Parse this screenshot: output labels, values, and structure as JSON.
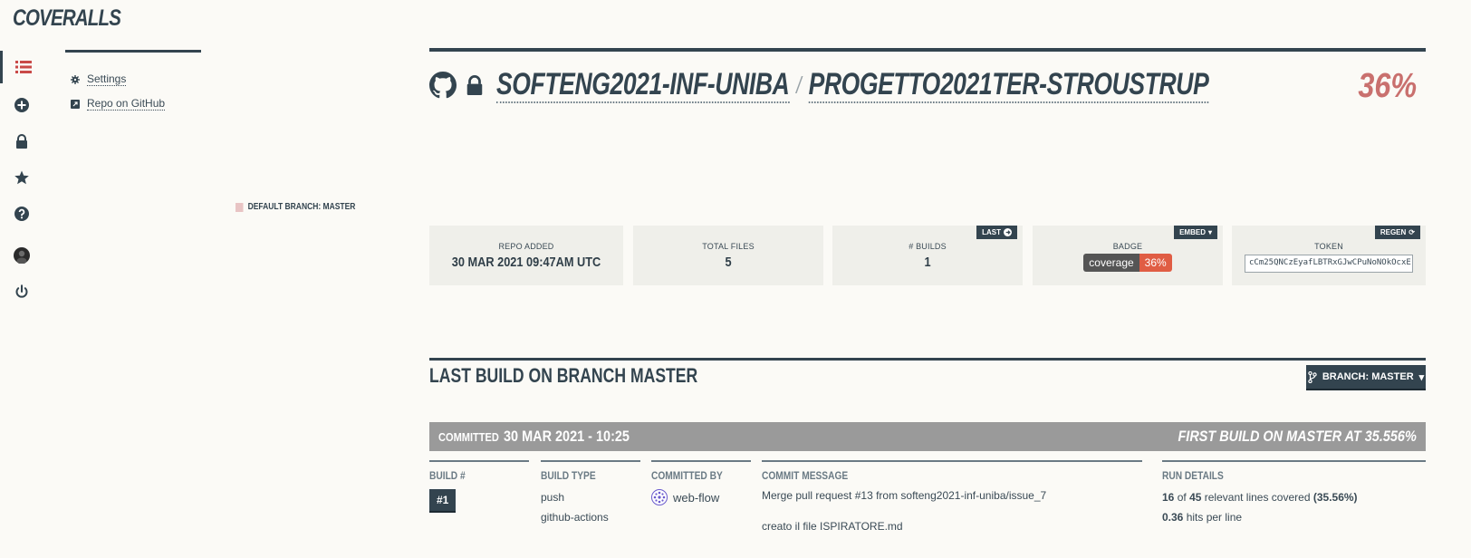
{
  "app": {
    "logo": "COVERALLS"
  },
  "rail": {
    "items": [
      {
        "icon": "list-icon",
        "active": true
      },
      {
        "icon": "add-circle-icon"
      },
      {
        "icon": "lock-icon"
      },
      {
        "icon": "star-icon"
      },
      {
        "icon": "help-icon"
      },
      {
        "icon": "avatar"
      },
      {
        "icon": "power-icon"
      }
    ]
  },
  "sidebar": {
    "links": [
      {
        "label": "Settings",
        "icon": "gear-icon"
      },
      {
        "label": "Repo on GitHub",
        "icon": "external-link-icon"
      }
    ]
  },
  "legend": {
    "label": "DEFAULT BRANCH: MASTER",
    "color": "#e8c4c4"
  },
  "repo": {
    "owner": "SOFTENG2021-INF-UNIBA",
    "separator": "/",
    "name": "PROGETTO2021TER-STROUSTRUP",
    "coverage": "36%"
  },
  "stats": {
    "repo_added": {
      "label": "REPO ADDED",
      "value": "30 MAR 2021 09:47AM UTC"
    },
    "total_files": {
      "label": "TOTAL FILES",
      "value": "5"
    },
    "builds": {
      "label": "# BUILDS",
      "value": "1",
      "tag": "LAST"
    },
    "badge": {
      "label": "BADGE",
      "tag": "EMBED",
      "left": "coverage",
      "right": "36%"
    },
    "token": {
      "label": "TOKEN",
      "tag": "REGEN",
      "value": "cCm25QNCzEyafLBTRxGJwCPuNoNOkOcxE"
    }
  },
  "last_build": {
    "title": "LAST BUILD ON BRANCH MASTER",
    "branch_button": "BRANCH: MASTER",
    "committed_label": "COMMITTED",
    "committed_date": "30 MAR 2021 - 10:25",
    "first_build": "FIRST BUILD ON MASTER AT 35.556%",
    "columns": {
      "build_num": {
        "header": "BUILD #",
        "value": "#1"
      },
      "build_type": {
        "header": "BUILD TYPE",
        "values": [
          "push",
          "github-actions"
        ]
      },
      "committed_by": {
        "header": "COMMITTED BY",
        "value": "web-flow"
      },
      "commit_message": {
        "header": "COMMIT MESSAGE",
        "line1": "Merge pull request #13 from softeng2021-inf-uniba/issue_7",
        "line2": "creato il file ISPIRATORE.md"
      },
      "run_details": {
        "header": "RUN DETAILS",
        "covered": "16",
        "of": "of",
        "relevant": "45",
        "relevant_text": "relevant lines covered",
        "pct": "(35.56%)",
        "hits": "0.36",
        "hits_text": "hits per line"
      }
    }
  }
}
